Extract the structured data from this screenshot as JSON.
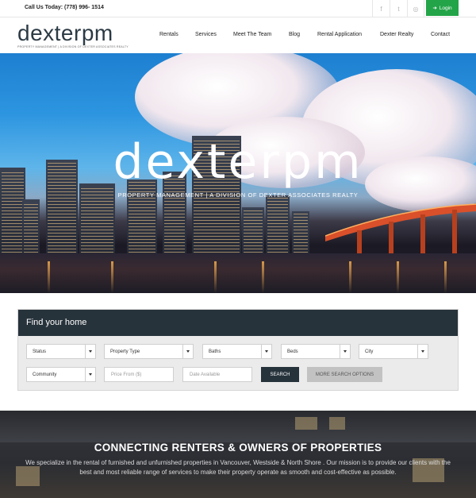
{
  "topbar": {
    "phone": "Call Us Today: (778) 996- 1514",
    "social": [
      {
        "icon": "facebook-icon",
        "glyph": "f"
      },
      {
        "icon": "twitter-icon",
        "glyph": "t"
      },
      {
        "icon": "instagram-icon",
        "glyph": "◎"
      }
    ],
    "login_label": "Login",
    "login_color": "#23a448"
  },
  "header": {
    "logo_main": "dexter",
    "logo_pm": "pm",
    "logo_sub": "PROPERTY MANAGEMENT | A DIVISION OF DEXTER ASSOCIATES REALTY",
    "nav": [
      "Rentals",
      "Services",
      "Meet The Team",
      "Blog",
      "Rental Application",
      "Dexter Realty",
      "Contact"
    ]
  },
  "hero": {
    "title": "dexterpm",
    "subtitle": "PROPERTY MANAGEMENT | A DIVISION OF DEXTER ASSOCIATES REALTY"
  },
  "search": {
    "heading": "Find your home",
    "selects": {
      "status": "Status",
      "property_type": "Property Type",
      "baths": "Baths",
      "beds": "Beds",
      "city": "City",
      "community": "Community"
    },
    "price_placeholder": "Price From ($)",
    "date_placeholder": "Date Available",
    "search_label": "SEARCH",
    "more_label": "MORE SEARCH OPTIONS",
    "header_color": "#27333b"
  },
  "banner": {
    "heading": "CONNECTING RENTERS & OWNERS OF PROPERTIES",
    "text": "We specialize in the rental of furnished and unfurnished properties in Vancouver, Westside & North Shore . Our mission is to provide our clients with the best and most reliable range of services to make their property operate as smooth and cost-effective as possible."
  }
}
